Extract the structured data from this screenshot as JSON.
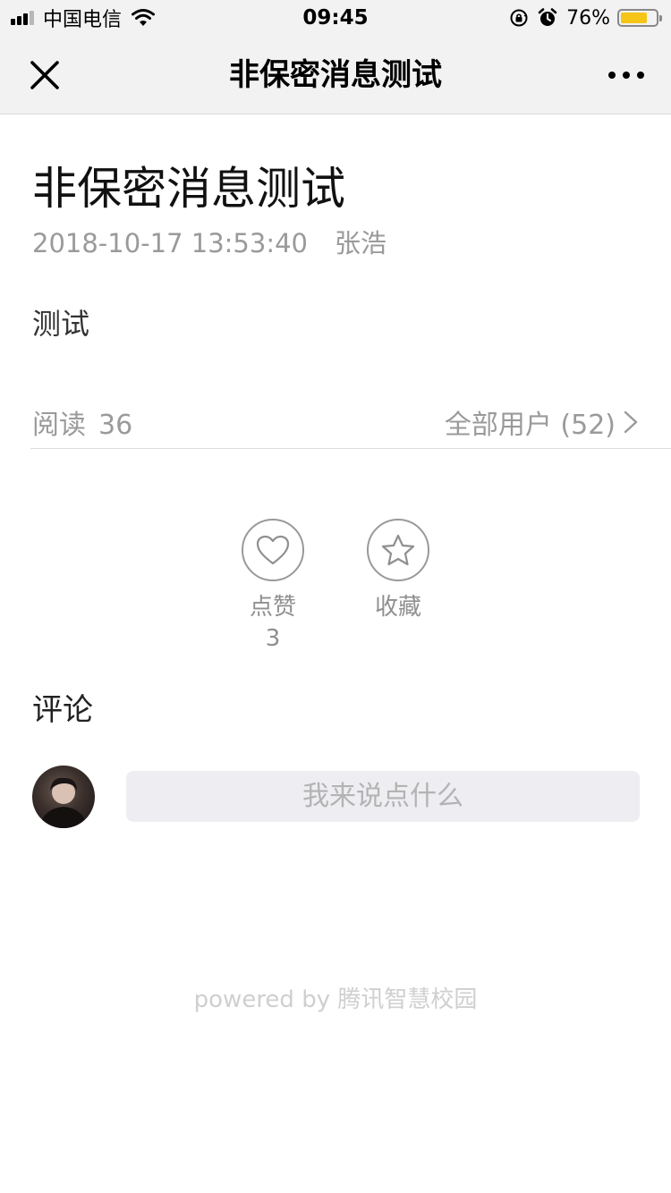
{
  "status_bar": {
    "carrier": "中国电信",
    "time": "09:45",
    "battery": "76%",
    "battery_level": 0.76,
    "battery_color": "#f5c518"
  },
  "nav": {
    "title": "非保密消息测试",
    "close_icon": "close-icon",
    "more_icon": "more-icon"
  },
  "article": {
    "title": "非保密消息测试",
    "date": "2018-10-17 13:53:40",
    "author": "张浩",
    "body": "测试"
  },
  "stats": {
    "read_label": "阅读",
    "read_count": "36",
    "all_users": "全部用户 (52)"
  },
  "actions": {
    "like_label": "点赞",
    "like_count": "3",
    "favorite_label": "收藏"
  },
  "comments": {
    "title": "评论",
    "placeholder": "我来说点什么"
  },
  "footer": "powered by 腾讯智慧校园"
}
